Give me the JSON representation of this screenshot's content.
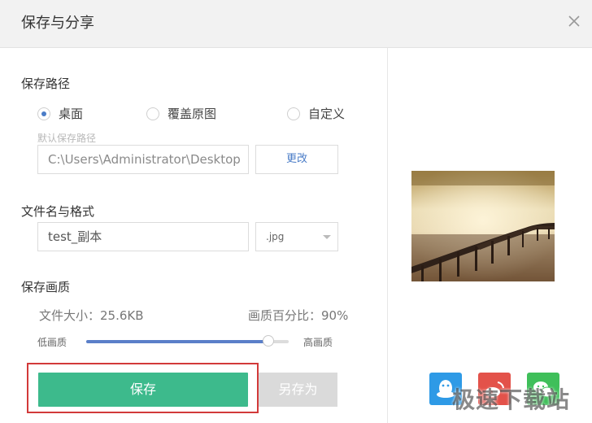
{
  "window": {
    "title": "保存与分享"
  },
  "save_path": {
    "label": "保存路径",
    "options": [
      "桌面",
      "覆盖原图",
      "自定义"
    ],
    "selected_index": 0,
    "hint": "默认保存路径",
    "path_value": "C:\\Users\\Administrator\\Desktop",
    "change_label": "更改"
  },
  "file": {
    "label": "文件名与格式",
    "name_value": "test_副本",
    "format_value": ".jpg"
  },
  "quality": {
    "label": "保存画质",
    "file_size_text": "文件大小：25.6KB",
    "percent_text": "画质百分比：90%",
    "percent": 90,
    "low_label": "低画质",
    "high_label": "高画质"
  },
  "buttons": {
    "save": "保存",
    "save_as": "另存为"
  },
  "share": {
    "targets": [
      "qq-icon",
      "weibo-icon",
      "wechat-icon"
    ]
  },
  "watermark": "极速下载站",
  "colors": {
    "accent": "#3dba8c",
    "highlight": "#d23a3a",
    "slider": "#5b7fc9",
    "radio": "#4a7cc7"
  }
}
